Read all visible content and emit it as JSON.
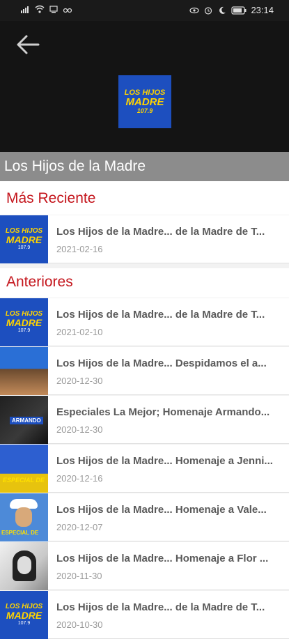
{
  "status_bar": {
    "signal": "signal-icon",
    "wifi": "wifi-icon",
    "time": "23:14",
    "battery": "battery-icon"
  },
  "header": {
    "back_icon": "arrow-left-icon",
    "cover_text_line1": "LOS HIJOS",
    "cover_text_line2": "MADRE",
    "cover_text_line3": "107.9"
  },
  "program_title": "Los Hijos de la Madre",
  "sections": {
    "recent": "Más Reciente",
    "previous": "Anteriores"
  },
  "recent_items": [
    {
      "title": "Los Hijos de la Madre... de la Madre de T...",
      "date": "2021-02-16",
      "thumb": "blue"
    }
  ],
  "previous_items": [
    {
      "title": "Los Hijos de la Madre... de la Madre de T...",
      "date": "2021-02-10",
      "thumb": "blue"
    },
    {
      "title": "Los Hijos de la Madre... Despidamos el a...",
      "date": "2020-12-30",
      "thumb": "crowd"
    },
    {
      "title": "Especiales La Mejor; Homenaje Armando...",
      "date": "2020-12-30",
      "thumb": "dark",
      "label": "ARMANDO"
    },
    {
      "title": "Los Hijos de la Madre... Homenaje a Jenni...",
      "date": "2020-12-16",
      "thumb": "especial",
      "label": "ESPECIAL DE"
    },
    {
      "title": "Los Hijos de la Madre... Homenaje a Vale...",
      "date": "2020-12-07",
      "thumb": "cowboy",
      "label": "ESPECIAL DE"
    },
    {
      "title": "Los Hijos de la Madre... Homenaje a Flor ...",
      "date": "2020-11-30",
      "thumb": "bw"
    },
    {
      "title": "Los Hijos de la Madre... de la Madre de T...",
      "date": "2020-10-30",
      "thumb": "blue"
    }
  ],
  "colors": {
    "accent": "#c4151c",
    "header_bg": "#141414",
    "title_bar_bg": "#8c8c8c",
    "cover_bg": "#1d4fbf",
    "cover_text": "#ffd400"
  }
}
